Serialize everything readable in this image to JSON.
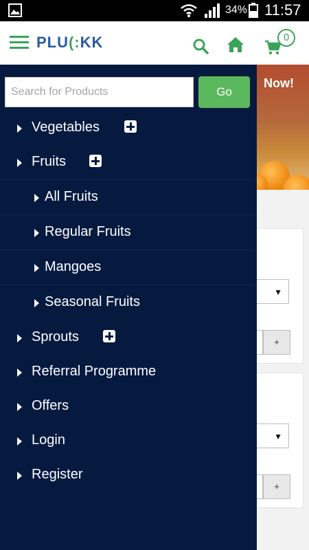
{
  "status_bar": {
    "battery": "34%",
    "time": "11:57"
  },
  "header": {
    "logo_a": "PLU",
    "logo_b": "(:",
    "logo_c": "KK",
    "cart_count": "0"
  },
  "drawer": {
    "search": {
      "placeholder": "Search for Products",
      "value": "",
      "button": "Go"
    },
    "items": [
      {
        "label": "Vegetables",
        "expandable": true,
        "level": 0
      },
      {
        "label": "Fruits",
        "expandable": true,
        "level": 0
      },
      {
        "label": "All Fruits",
        "level": 1
      },
      {
        "label": "Regular Fruits",
        "level": 1
      },
      {
        "label": "Mangoes",
        "level": 1
      },
      {
        "label": "Seasonal Fruits",
        "level": 1
      },
      {
        "label": "Sprouts",
        "expandable": true,
        "level": 0
      },
      {
        "label": "Referral Programme",
        "level": 0
      },
      {
        "label": "Offers",
        "level": 0
      },
      {
        "label": "Login",
        "level": 0
      },
      {
        "label": "Register",
        "level": 0
      }
    ]
  },
  "background_page": {
    "banner_text": "Now!",
    "cards": [
      {
        "stepper_label": "+"
      },
      {
        "stepper_label": "+"
      }
    ]
  },
  "colors": {
    "drawer_bg": "#061a40",
    "accent_green": "#5cb85c",
    "brand_blue": "#2a5aa0",
    "icon_green": "#3aa35a"
  }
}
